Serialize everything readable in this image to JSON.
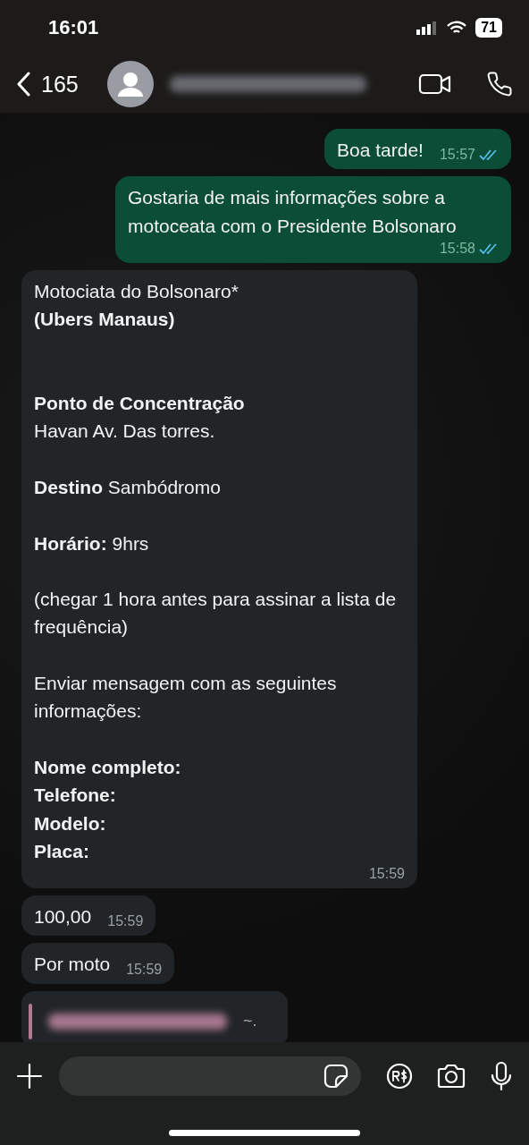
{
  "status_bar": {
    "time": "16:01",
    "battery": "71"
  },
  "header": {
    "back_count": "165"
  },
  "messages": [
    {
      "kind": "outgoing",
      "text": "Boa tarde!",
      "time": "15:57",
      "read": true
    },
    {
      "kind": "outgoing",
      "text": "Gostaria de mais informações sobre a motoceata com o Presidente Bolsonaro",
      "time": "15:58",
      "read": true
    },
    {
      "kind": "incoming",
      "text": "Motociata do Bolsonaro*\n**(Ubers Manaus)**\n\n\n**Ponto de Concentração**\nHavan Av. Das torres.\n\n**Destino** Sambódromo\n\n**Horário:** 9hrs\n\n(chegar 1 hora antes para assinar a lista de frequência)\n\nEnviar mensagem com as seguintes informações:\n\n**Nome completo:\nTelefone:\nModelo:\nPlaca:**",
      "time": "15:59"
    },
    {
      "kind": "incoming",
      "text": "100,00",
      "time": "15:59"
    },
    {
      "kind": "incoming",
      "text": "Por moto",
      "time": "15:59"
    },
    {
      "kind": "contact",
      "text": "~."
    }
  ]
}
